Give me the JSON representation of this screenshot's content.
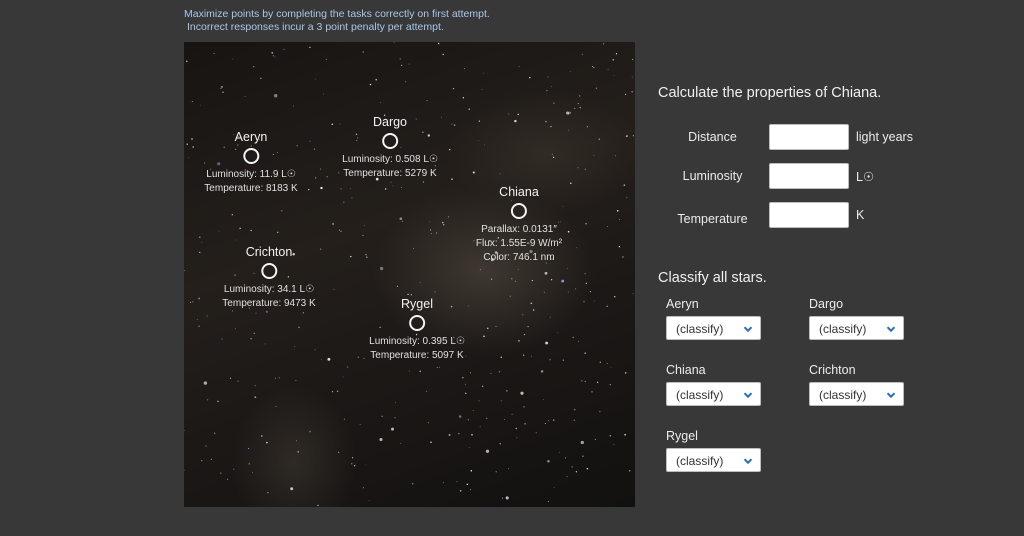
{
  "instructions": {
    "line1": "Maximize points by completing the tasks correctly on first attempt.",
    "line2": "Incorrect responses incur a 3 point penalty per attempt."
  },
  "stars": {
    "aeryn": {
      "name": "Aeryn",
      "line1": "Luminosity:  11.9 L☉",
      "line2": "Temperature:  8183 K"
    },
    "dargo": {
      "name": "Dargo",
      "line1": "Luminosity:  0.508 L☉",
      "line2": "Temperature:  5279 K"
    },
    "chiana": {
      "name": "Chiana",
      "line1": "Parallax:  0.0131″",
      "line2": "Flux:  1.55E-9 W/m²",
      "line3": "Color:  746.1 nm"
    },
    "crichton": {
      "name": "Crichton",
      "line1": "Luminosity:  34.1 L☉",
      "line2": "Temperature:  9473 K"
    },
    "rygel": {
      "name": "Rygel",
      "line1": "Luminosity:  0.395 L☉",
      "line2": "Temperature:  5097 K"
    }
  },
  "properties": {
    "title": "Calculate the properties of Chiana.",
    "distance": {
      "label": "Distance",
      "value": "",
      "unit": "light years"
    },
    "luminosity": {
      "label": "Luminosity",
      "value": "",
      "unit": "L☉"
    },
    "temperature": {
      "label": "Temperature",
      "value": "",
      "unit": "K"
    }
  },
  "classify": {
    "title": "Classify all stars.",
    "items": [
      {
        "label": "Aeryn",
        "selected": "(classify)"
      },
      {
        "label": "Dargo",
        "selected": "(classify)"
      },
      {
        "label": "Chiana",
        "selected": "(classify)"
      },
      {
        "label": "Crichton",
        "selected": "(classify)"
      },
      {
        "label": "Rygel",
        "selected": "(classify)"
      }
    ]
  },
  "icons": {
    "star_marker": "circle-outline-icon",
    "dropdown": "chevron-down-icon"
  },
  "colors": {
    "background": "#383838",
    "instruction_text": "#a9c6e8",
    "chevron": "#2a6fb5"
  }
}
